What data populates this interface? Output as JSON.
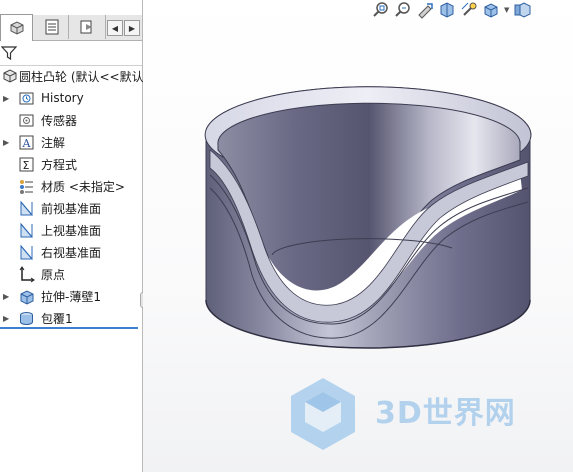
{
  "feature_tree": {
    "part_name": "圆柱凸轮 (默认<<默认",
    "items": [
      {
        "label": "History",
        "icon": "history-icon",
        "expandable": true
      },
      {
        "label": "传感器",
        "icon": "sensor-icon",
        "expandable": false
      },
      {
        "label": "注解",
        "icon": "annotation-icon",
        "expandable": true
      },
      {
        "label": "方程式",
        "icon": "equation-icon",
        "expandable": false
      },
      {
        "label": "材质 <未指定>",
        "icon": "material-icon",
        "expandable": false
      },
      {
        "label": "前视基准面",
        "icon": "plane-icon",
        "expandable": false
      },
      {
        "label": "上视基准面",
        "icon": "plane-icon",
        "expandable": false
      },
      {
        "label": "右视基准面",
        "icon": "plane-icon",
        "expandable": false
      },
      {
        "label": "原点",
        "icon": "origin-icon",
        "expandable": false
      },
      {
        "label": "拉伸-薄壁1",
        "icon": "extrude-icon",
        "expandable": true
      },
      {
        "label": "包覆1",
        "icon": "wrap-icon",
        "expandable": true
      }
    ]
  },
  "panel_tabs": [
    "feature-manager",
    "property-manager",
    "configuration-manager"
  ],
  "hud_icons": [
    "zoom-to-fit-icon",
    "zoom-area-icon",
    "previous-view-icon",
    "section-view-icon",
    "dynamic-annotation-icon",
    "view-orientation-icon",
    "display-style-icon"
  ],
  "watermark": {
    "text": "3D世界网"
  },
  "colors": {
    "accent": "#3d7fd1",
    "model_body": "#8a8ba3",
    "watermark": "#9dc6ea"
  }
}
